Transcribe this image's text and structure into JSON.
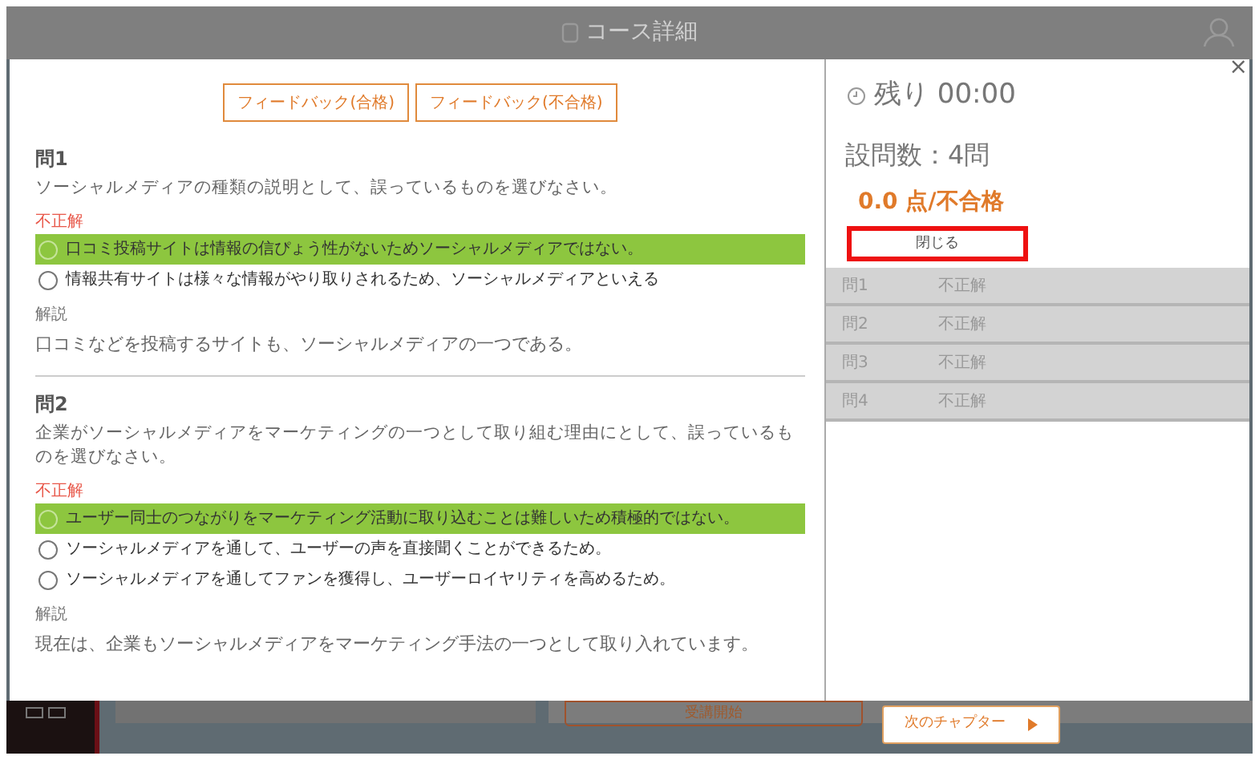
{
  "header": {
    "title": "コース詳細"
  },
  "feedback_buttons": [
    "フィードバック(合格)",
    "フィードバック(不合格)"
  ],
  "questions": [
    {
      "title": "問1",
      "text": "ソーシャルメディアの種類の説明として、誤っているものを選びなさい。",
      "result": "不正解",
      "options": [
        {
          "text": "口コミ投稿サイトは情報の信ぴょう性がないためソーシャルメディアではない。",
          "highlighted": true
        },
        {
          "text": "情報共有サイトは様々な情報がやり取りされるため、ソーシャルメディアといえる",
          "highlighted": false
        }
      ],
      "explanation_label": "解説",
      "explanation": "口コミなどを投稿するサイトも、ソーシャルメディアの一つである。"
    },
    {
      "title": "問2",
      "text": "企業がソーシャルメディアをマーケティングの一つとして取り組む理由にとして、誤っているものを選びなさい。",
      "result": "不正解",
      "options": [
        {
          "text": "ユーザー同士のつながりをマーケティング活動に取り込むことは難しいため積極的ではない。",
          "highlighted": true
        },
        {
          "text": "ソーシャルメディアを通して、ユーザーの声を直接聞くことができるため。",
          "highlighted": false
        },
        {
          "text": "ソーシャルメディアを通してファンを獲得し、ユーザーロイヤリティを高めるため。",
          "highlighted": false
        }
      ],
      "explanation_label": "解説",
      "explanation": "現在は、企業もソーシャルメディアをマーケティング手法の一つとして取り入れています。"
    }
  ],
  "summary": {
    "close_mark": "×",
    "remaining": "残り 00:00",
    "question_count": "設問数：4問",
    "score": "0.0 点/不合格",
    "close_button": "閉じる",
    "results": [
      {
        "question": "問1",
        "result": "不正解"
      },
      {
        "question": "問2",
        "result": "不正解"
      },
      {
        "question": "問3",
        "result": "不正解"
      },
      {
        "question": "問4",
        "result": "不正解"
      }
    ]
  },
  "footer": {
    "start_button": "受講開始",
    "next_button": "次のチャプター"
  }
}
